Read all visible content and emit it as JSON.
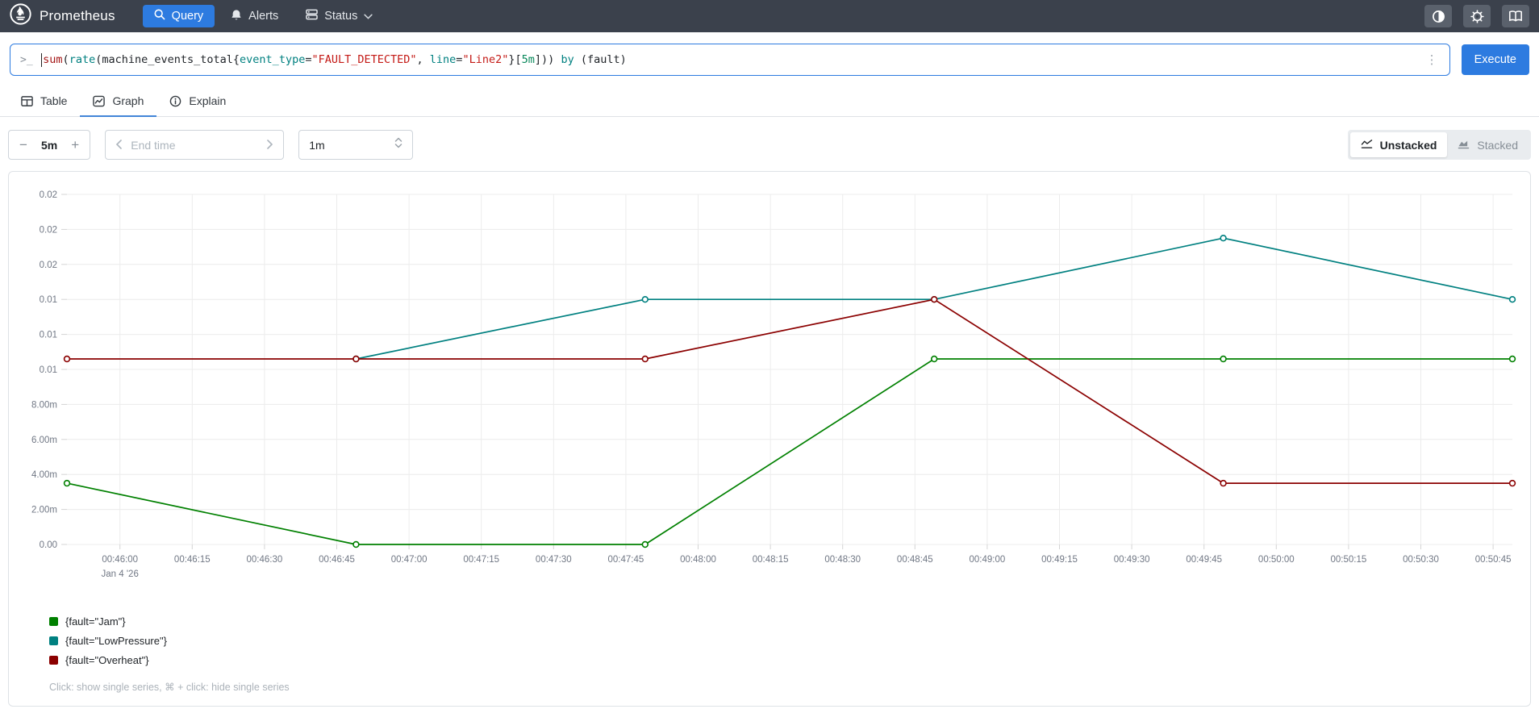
{
  "navbar": {
    "brand": "Prometheus",
    "items": [
      {
        "label": "Query"
      },
      {
        "label": "Alerts"
      },
      {
        "label": "Status"
      }
    ]
  },
  "query_bar": {
    "tokens": [
      {
        "t": "sum",
        "c": "kw"
      },
      {
        "t": "(",
        "c": "p"
      },
      {
        "t": "rate",
        "c": "fn"
      },
      {
        "t": "(",
        "c": "p"
      },
      {
        "t": "machine_events_total",
        "c": "metric"
      },
      {
        "t": "{",
        "c": "p"
      },
      {
        "t": "event_type",
        "c": "label"
      },
      {
        "t": "=",
        "c": "p"
      },
      {
        "t": "\"FAULT_DETECTED\"",
        "c": "str"
      },
      {
        "t": ", ",
        "c": "p"
      },
      {
        "t": "line",
        "c": "label"
      },
      {
        "t": "=",
        "c": "p"
      },
      {
        "t": "\"Line2\"",
        "c": "str"
      },
      {
        "t": "}",
        "c": "p"
      },
      {
        "t": "[",
        "c": "p"
      },
      {
        "t": "5m",
        "c": "dur"
      },
      {
        "t": "]",
        "c": "p"
      },
      {
        "t": "))",
        "c": "p"
      },
      {
        "t": " ",
        "c": "p"
      },
      {
        "t": "by",
        "c": "kw2"
      },
      {
        "t": " ",
        "c": "p"
      },
      {
        "t": "(fault)",
        "c": "p"
      }
    ],
    "execute_label": "Execute"
  },
  "tabs": [
    {
      "label": "Table"
    },
    {
      "label": "Graph"
    },
    {
      "label": "Explain"
    }
  ],
  "controls": {
    "duration": "5m",
    "minus": "−",
    "plus": "+",
    "end_time_placeholder": "End time",
    "resolution": "1m",
    "unstacked_label": "Unstacked",
    "stacked_label": "Stacked"
  },
  "chart_data": {
    "type": "line",
    "x_domain": [
      0,
      300
    ],
    "y_domain": [
      0,
      0.02
    ],
    "x_domain_times": [
      "00:45:49",
      "00:50:49"
    ],
    "grid": true,
    "legend_position": "bottom-left",
    "x_ticks": [
      {
        "t": 11,
        "label": "00:46:00",
        "sub": "Jan 4 '26"
      },
      {
        "t": 26,
        "label": "00:46:15"
      },
      {
        "t": 41,
        "label": "00:46:30"
      },
      {
        "t": 56,
        "label": "00:46:45"
      },
      {
        "t": 71,
        "label": "00:47:00"
      },
      {
        "t": 86,
        "label": "00:47:15"
      },
      {
        "t": 101,
        "label": "00:47:30"
      },
      {
        "t": 116,
        "label": "00:47:45"
      },
      {
        "t": 131,
        "label": "00:48:00"
      },
      {
        "t": 146,
        "label": "00:48:15"
      },
      {
        "t": 161,
        "label": "00:48:30"
      },
      {
        "t": 176,
        "label": "00:48:45"
      },
      {
        "t": 191,
        "label": "00:49:00"
      },
      {
        "t": 206,
        "label": "00:49:15"
      },
      {
        "t": 221,
        "label": "00:49:30"
      },
      {
        "t": 236,
        "label": "00:49:45"
      },
      {
        "t": 251,
        "label": "00:50:00"
      },
      {
        "t": 266,
        "label": "00:50:15"
      },
      {
        "t": 281,
        "label": "00:50:30"
      },
      {
        "t": 296,
        "label": "00:50:45"
      }
    ],
    "y_ticks": [
      {
        "v": 0.02,
        "label": "0.02"
      },
      {
        "v": 0.018,
        "label": "0.02"
      },
      {
        "v": 0.016,
        "label": "0.02"
      },
      {
        "v": 0.014,
        "label": "0.01"
      },
      {
        "v": 0.012,
        "label": "0.01"
      },
      {
        "v": 0.01,
        "label": "0.01"
      },
      {
        "v": 0.008,
        "label": "8.00m"
      },
      {
        "v": 0.006,
        "label": "6.00m"
      },
      {
        "v": 0.004,
        "label": "4.00m"
      },
      {
        "v": 0.002,
        "label": "2.00m"
      },
      {
        "v": 0.0,
        "label": "0.00"
      }
    ],
    "series": [
      {
        "name": "{fault=\"Jam\"}",
        "color": "#008000",
        "points": [
          [
            0,
            0.0035
          ],
          [
            60,
            0
          ],
          [
            120,
            0
          ],
          [
            180,
            0.0106
          ],
          [
            240,
            0.0106
          ],
          [
            300,
            0.0106
          ]
        ]
      },
      {
        "name": "{fault=\"LowPressure\"}",
        "color": "#008080",
        "points": [
          [
            60,
            0.0106
          ],
          [
            120,
            0.014
          ],
          [
            180,
            0.014
          ],
          [
            240,
            0.0175
          ],
          [
            300,
            0.014
          ]
        ]
      },
      {
        "name": "{fault=\"Overheat\"}",
        "color": "#8b0000",
        "points": [
          [
            0,
            0.0106
          ],
          [
            60,
            0.0106
          ],
          [
            120,
            0.0106
          ],
          [
            180,
            0.014
          ],
          [
            240,
            0.0035
          ],
          [
            300,
            0.0035
          ]
        ]
      }
    ]
  },
  "legend_hint": "Click: show single series, ⌘ + click: hide single series",
  "colors": {
    "accent": "#2d7be0",
    "navbar_bg": "#3b414c",
    "grid": "#ececec"
  }
}
